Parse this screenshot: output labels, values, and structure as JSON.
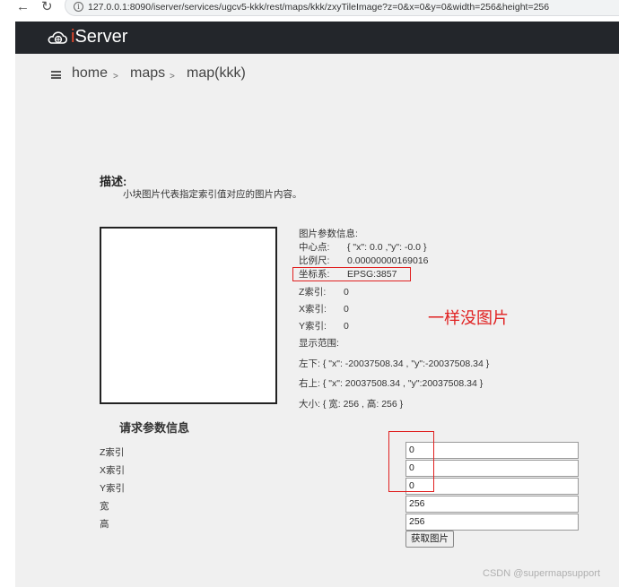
{
  "browser": {
    "back_icon": "arrow-left-icon",
    "reload_icon": "reload-icon",
    "info_icon": "info-icon",
    "url": "127.0.0.1:8090/iserver/services/ugcv5-kkk/rest/maps/kkk/zxyTileImage?z=0&x=0&y=0&width=256&height=256"
  },
  "header": {
    "logo_prefix": "i",
    "logo_name": "Server",
    "logo_icon": "cloud-globe-icon"
  },
  "breadcrumb": {
    "icon": "list-icon",
    "items": [
      "home",
      "maps",
      "map(kkk)"
    ],
    "separator": ">"
  },
  "description": {
    "title": "描述:",
    "text": "小块图片代表指定索引值对应的图片内容。"
  },
  "image_params": {
    "title": "图片参数信息:",
    "center_label": "中心点:",
    "center_value": "{ \"x\": 0.0 ,\"y\": -0.0 }",
    "scale_label": "比例尺:",
    "scale_value": "0.00000000169016",
    "crs_label": "坐标系:",
    "crs_value": "EPSG:3857",
    "z_label": "Z索引:",
    "z_value": "0",
    "x_label": "X索引:",
    "x_value": "0",
    "y_label": "Y索引:",
    "y_value": "0",
    "bounds_label": "显示范围:",
    "lower_left": "左下: { \"x\": -20037508.34 , \"y\":-20037508.34 }",
    "upper_right": "右上: { \"x\": 20037508.34 , \"y\":20037508.34 }",
    "size": "大小: { 宽: 256 , 高: 256 }"
  },
  "annotation": {
    "text": "一样没图片",
    "color": "#e02020"
  },
  "request_params": {
    "title": "请求参数信息",
    "fields": [
      {
        "label": "Z索引",
        "value": "0"
      },
      {
        "label": "X索引",
        "value": "0"
      },
      {
        "label": "Y索引",
        "value": "0"
      },
      {
        "label": "宽",
        "value": "256"
      },
      {
        "label": "高",
        "value": "256"
      }
    ],
    "submit_label": "获取图片"
  },
  "watermark": "CSDN @supermapsupport",
  "colors": {
    "header_bg": "#23262b",
    "content_bg": "#f0f0f0",
    "logo_accent": "#e8492d",
    "highlight_red": "#e02020"
  }
}
